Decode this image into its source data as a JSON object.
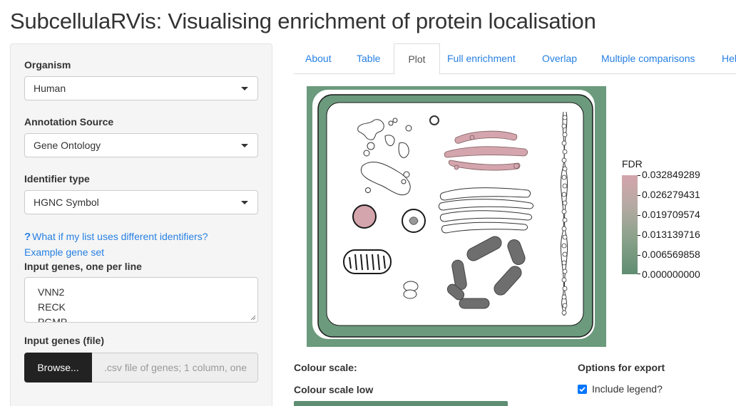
{
  "page": {
    "title": "SubcellulaRVis: Visualising enrichment of protein localisation"
  },
  "sidebar": {
    "organism": {
      "label": "Organism",
      "value": "Human"
    },
    "annotation_source": {
      "label": "Annotation Source",
      "value": "Gene Ontology"
    },
    "identifier_type": {
      "label": "Identifier type",
      "value": "HGNC Symbol"
    },
    "help_link": {
      "icon": "?",
      "text": "What if my list uses different identifiers?"
    },
    "example_link": "Example gene set",
    "genes_input": {
      "label": "Input genes, one per line",
      "lines": [
        "VNN2",
        "RECK",
        "PGMP"
      ]
    },
    "genes_file": {
      "label": "Input genes (file)",
      "button": "Browse...",
      "placeholder": ".csv file of genes; 1 column, one"
    }
  },
  "tabs": [
    {
      "label": "About",
      "active": false
    },
    {
      "label": "Table",
      "active": false
    },
    {
      "label": "Plot",
      "active": true
    },
    {
      "label": "Full enrichment",
      "active": false
    },
    {
      "label": "Overlap",
      "active": false
    },
    {
      "label": "Multiple comparisons",
      "active": false
    },
    {
      "label": "Help",
      "active": false
    }
  ],
  "plot": {
    "legend_title": "FDR",
    "legend_values": [
      "0.032849289",
      "0.026279431",
      "0.019709574",
      "0.013139716",
      "0.006569858",
      "0.000000000"
    ],
    "colors": {
      "high": "#d4a5ac",
      "low": "#5f8d72",
      "cell_wall": "#6b9a7c",
      "enriched_organelle": "#c9969b"
    }
  },
  "options": {
    "colour_scale": "Colour scale:",
    "colour_scale_low": "Colour scale low",
    "colour_scale_low_color": "#5f8d72",
    "export_title": "Options for export",
    "include_legend": {
      "label": "Include legend?",
      "checked": true
    }
  },
  "colors": {
    "accent": "#2780e3",
    "sidebar_bg": "#f5f5f5",
    "button_dark": "#222222"
  }
}
